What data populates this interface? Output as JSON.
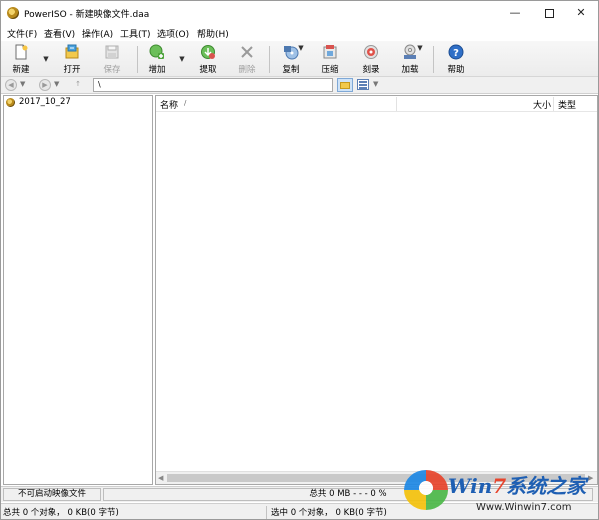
{
  "window": {
    "title": "PowerISO - 新建映像文件.daa",
    "minimize": "—",
    "close": "✕"
  },
  "menu": [
    "文件(F)",
    "查看(V)",
    "操作(A)",
    "工具(T)",
    "选项(O)",
    "帮助(H)"
  ],
  "toolbar": {
    "new": "新建",
    "open": "打开",
    "save": "保存",
    "add": "增加",
    "extract": "提取",
    "delete": "删除",
    "copy": "复制",
    "compress": "压缩",
    "burn": "刻录",
    "mount": "加载",
    "help": "帮助",
    "disabled_color": "#a0a0a0"
  },
  "addressbar": {
    "path": "\\"
  },
  "tree": {
    "root_label": "2017_10_27"
  },
  "filelist": {
    "columns": [
      "名称",
      "大小",
      "类型"
    ],
    "sort_indicator": "/"
  },
  "status": {
    "boot": "不可启动映像文件",
    "total": "总共 0 MB   - - - 0 %",
    "objects_total": "总共 0 个对象， 0 KB(0 字节)",
    "objects_selected": "选中 0 个对象， 0 KB(0 字节)"
  },
  "watermark": {
    "brand_part1": "Win",
    "brand_part2": "7",
    "brand_part3": "系统之家",
    "url": "Www.Winwin7.com"
  }
}
